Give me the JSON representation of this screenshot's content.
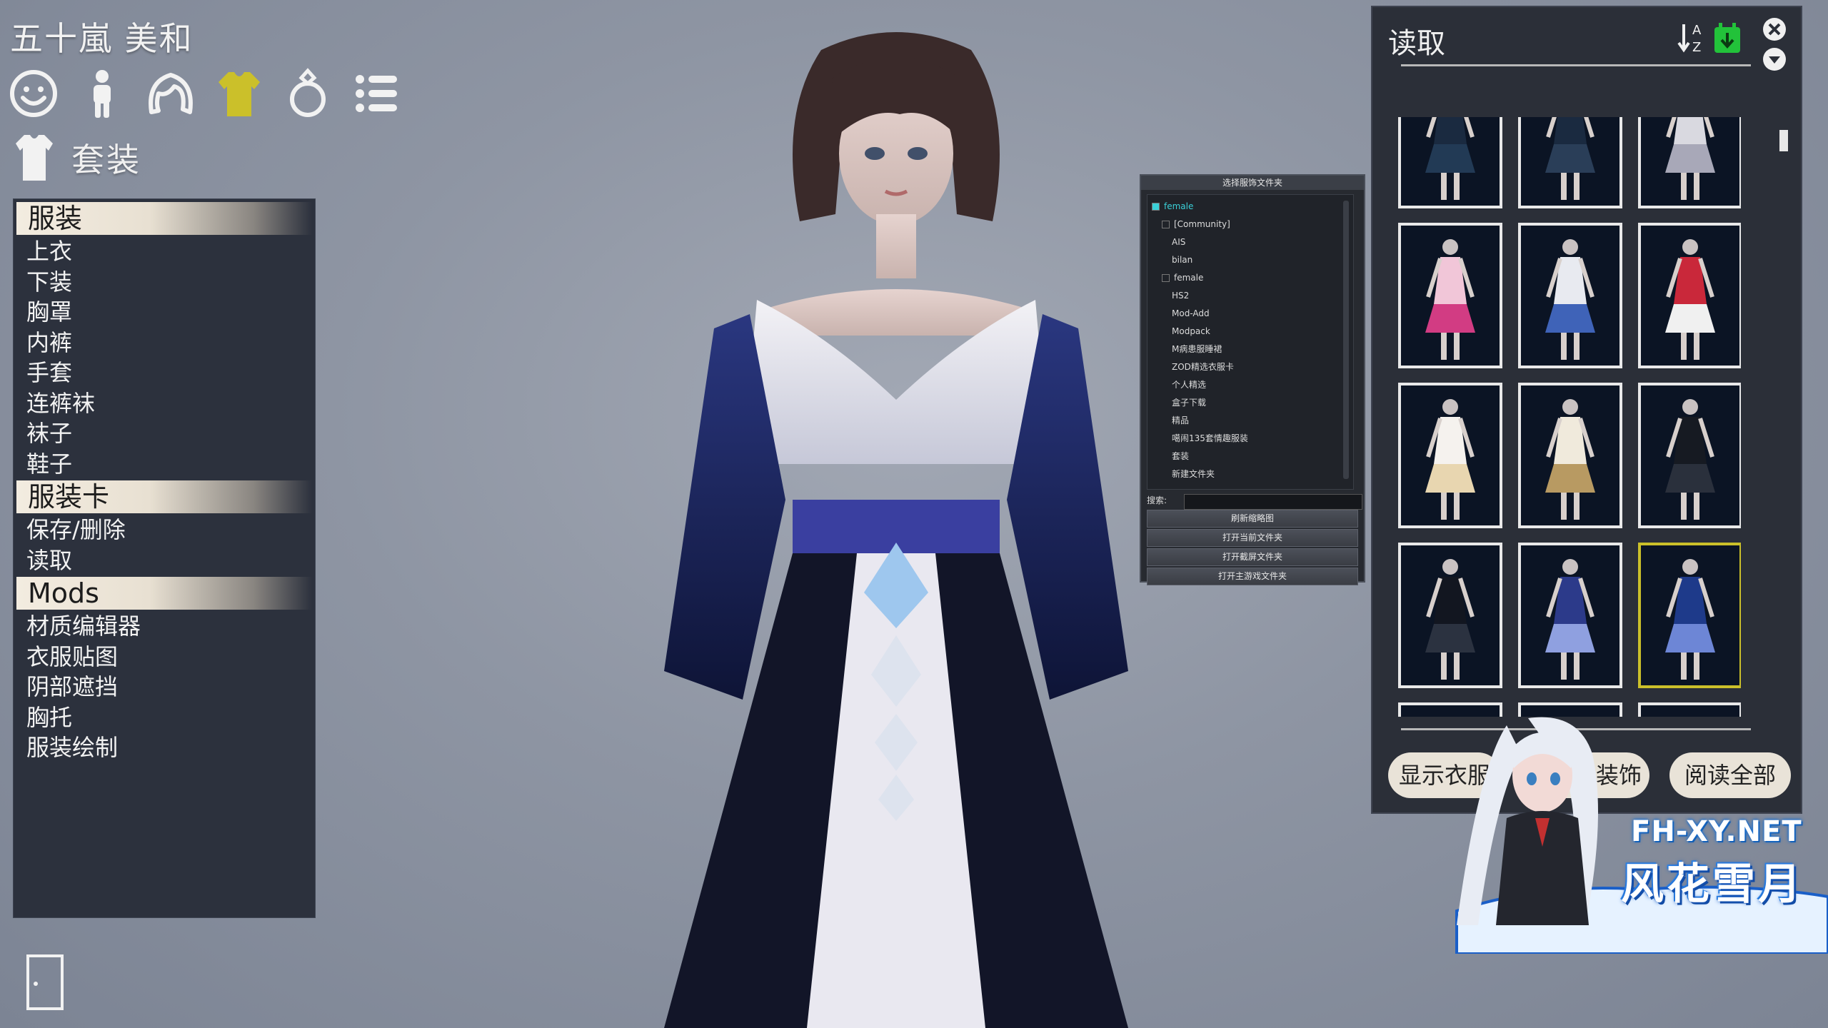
{
  "character_name": "五十嵐 美和",
  "category_icons": [
    "face-icon",
    "body-icon",
    "hair-icon",
    "clothing-icon",
    "accessory-icon",
    "list-icon"
  ],
  "section_title": "套装",
  "menu": {
    "groups": [
      {
        "title": "服装",
        "items": [
          "上衣",
          "下装",
          "胸罩",
          "内裤",
          "手套",
          "连裤袜",
          "袜子",
          "鞋子"
        ]
      },
      {
        "title": "服装卡",
        "items": [
          "保存/删除",
          "读取"
        ]
      },
      {
        "title": "Mods",
        "items": [
          "材质编辑器",
          "衣服贴图",
          "阴部遮挡",
          "胸托",
          "服装绘制"
        ]
      }
    ]
  },
  "folder_panel": {
    "title": "选择服饰文件夹",
    "tree": [
      {
        "label": "female",
        "level": 0,
        "selected": true
      },
      {
        "label": "[Community]",
        "level": 1,
        "selected": false
      },
      {
        "label": "AIS",
        "level": 2,
        "selected": false
      },
      {
        "label": "bilan",
        "level": 2,
        "selected": false
      },
      {
        "label": "female",
        "level": 1,
        "selected": false
      },
      {
        "label": "HS2",
        "level": 2,
        "selected": false
      },
      {
        "label": "Mod-Add",
        "level": 2,
        "selected": false
      },
      {
        "label": "Modpack",
        "level": 2,
        "selected": false
      },
      {
        "label": "M病患服睡裙",
        "level": 2,
        "selected": false
      },
      {
        "label": "ZOD精选衣服卡",
        "level": 2,
        "selected": false
      },
      {
        "label": "个人精选",
        "level": 2,
        "selected": false
      },
      {
        "label": "盒子下载",
        "level": 2,
        "selected": false
      },
      {
        "label": "精品",
        "level": 2,
        "selected": false
      },
      {
        "label": "噶闹135套情趣服装",
        "level": 2,
        "selected": false
      },
      {
        "label": "套装",
        "level": 2,
        "selected": false
      },
      {
        "label": "新建文件夹",
        "level": 2,
        "selected": false
      }
    ],
    "search_label": "搜索:",
    "search_value": "",
    "buttons": [
      "刷新缩略图",
      "打开当前文件夹",
      "打开截屏文件夹",
      "打开主游戏文件夹"
    ]
  },
  "load_panel": {
    "title": "读取",
    "icons": {
      "sort": "sort-az-icon",
      "import": "import-icon",
      "close": "close-icon",
      "collapse": "chevron-down-icon"
    },
    "cards": [
      {
        "dress": "#1a2a40",
        "accent": "#223a55"
      },
      {
        "dress": "#1a2a40",
        "accent": "#2a3e58"
      },
      {
        "dress": "#d9d9e0",
        "accent": "#a8a8b8"
      },
      {
        "dress": "#f1c6d8",
        "accent": "#d23c83"
      },
      {
        "dress": "#e8eaf0",
        "accent": "#3f63b8"
      },
      {
        "dress": "#c9283a",
        "accent": "#f0f0f0"
      },
      {
        "dress": "#f5f2ee",
        "accent": "#e8d6b0"
      },
      {
        "dress": "#f0eadc",
        "accent": "#b89a62"
      },
      {
        "dress": "#161a22",
        "accent": "#2a303c"
      },
      {
        "dress": "#121620",
        "accent": "#2b3240"
      },
      {
        "dress": "#2c3a8a",
        "accent": "#8fa0e0"
      },
      {
        "dress": "#1e3a8a",
        "accent": "#6d86d6"
      },
      {
        "dress": "#bdbfcc",
        "accent": "#6b6f88"
      },
      {
        "dress": "#c9c9d6",
        "accent": "#7a7e96"
      },
      {
        "dress": "#b8b8c6",
        "accent": "#6c7088"
      }
    ],
    "selected_index": 11,
    "buttons": {
      "show": "显示衣服",
      "load": "读取装饰",
      "load_all": "阅读全部"
    }
  },
  "watermark": {
    "site": "FH-XY.NET",
    "brand": "风花雪月"
  },
  "colors": {
    "accent_yellow": "#cbc02a",
    "panel_bg": "#2c313d",
    "menu_header": "#f3ece0",
    "tree_selected": "#3ad0d8"
  }
}
